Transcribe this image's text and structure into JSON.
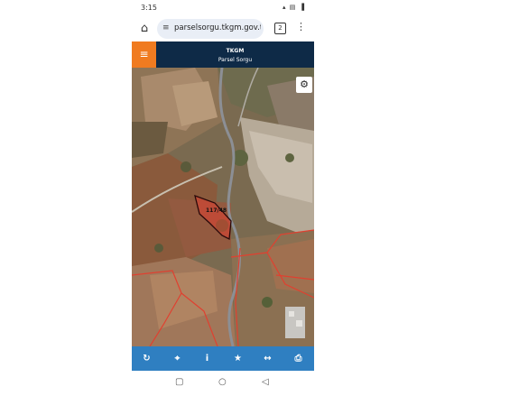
{
  "status": {
    "time": "3:15",
    "icons": "wifi signal battery"
  },
  "browser": {
    "url": "parselsorgu.tkgm.gov.tr/",
    "tab_count": "2"
  },
  "header": {
    "title": "TKGM",
    "subtitle": "Parsel Sorgu"
  },
  "map": {
    "parcel_label": "117/48"
  },
  "toolbar": {
    "items": [
      "refresh-icon",
      "locate-icon",
      "info-icon",
      "favorite-icon",
      "measure-icon",
      "print-icon"
    ]
  },
  "colors": {
    "header": "#0e2a47",
    "menu_button": "#f07b20",
    "toolbar": "#2f7fc1",
    "parcel": "#e04030"
  }
}
